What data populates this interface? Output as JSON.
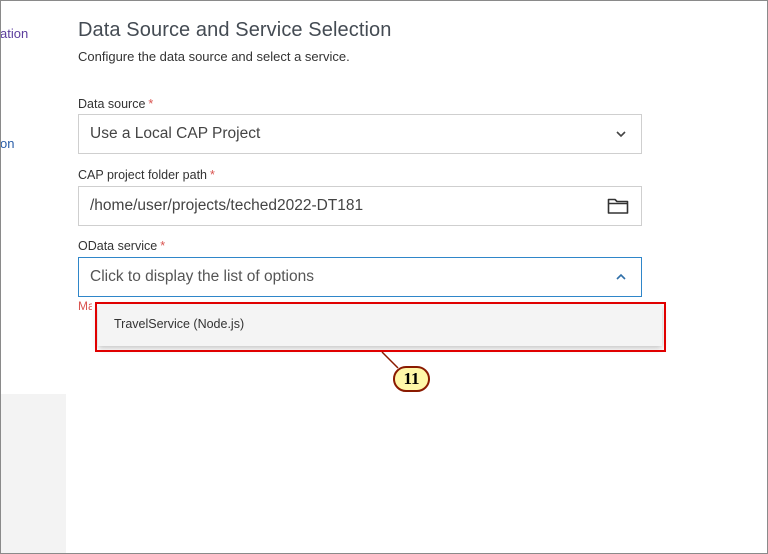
{
  "sidebar": {
    "item1_fragment": "ation",
    "item2_fragment": "on"
  },
  "header": {
    "title": "Data Source and Service Selection",
    "description": "Configure the data source and select a service."
  },
  "form": {
    "data_source": {
      "label": "Data source",
      "required_marker": "*",
      "value": "Use a Local CAP Project"
    },
    "cap_folder": {
      "label": "CAP project folder path",
      "required_marker": "*",
      "value": "/home/user/projects/teched2022-DT181"
    },
    "odata_service": {
      "label": "OData service",
      "required_marker": "*",
      "placeholder": "Click to display the list of options",
      "error_fragment": "Ma",
      "options": [
        "TravelService (Node.js)"
      ]
    }
  },
  "annotation": {
    "step_number": "11",
    "highlight_color": "#e00000",
    "badge_color": "#fff7a8"
  },
  "colors": {
    "focus_border": "#2f86c9",
    "required": "#d9534f",
    "title": "#444b53"
  }
}
